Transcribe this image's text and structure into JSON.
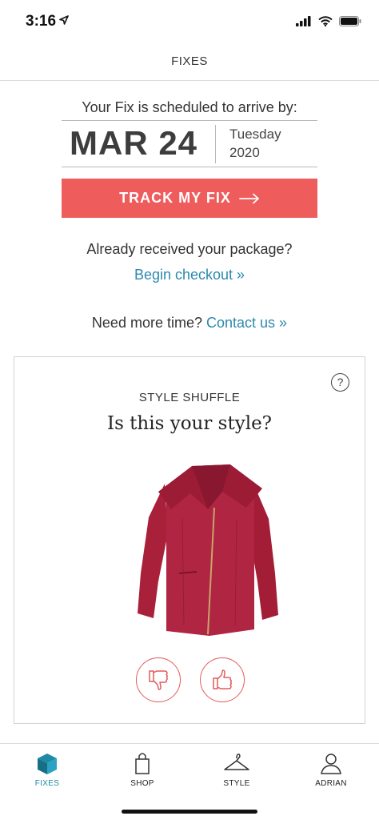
{
  "status_bar": {
    "time": "3:16"
  },
  "header": {
    "title": "FIXES"
  },
  "schedule": {
    "caption": "Your Fix is scheduled to arrive by:",
    "date": "MAR 24",
    "weekday": "Tuesday",
    "year": "2020"
  },
  "track_button": {
    "label": "TRACK MY FIX"
  },
  "checkout": {
    "question": "Already received your package?",
    "link": "Begin checkout »"
  },
  "more_time": {
    "question": "Need more time?",
    "link": "Contact us »"
  },
  "style_shuffle": {
    "help": "?",
    "kicker": "STYLE SHUFFLE",
    "heading": "Is this your style?",
    "item_color": "#a8203a"
  },
  "tabbar": {
    "tabs": [
      {
        "label": "FIXES",
        "active": true
      },
      {
        "label": "SHOP",
        "active": false
      },
      {
        "label": "STYLE",
        "active": false
      },
      {
        "label": "ADRIAN",
        "active": false
      }
    ]
  },
  "colors": {
    "accent_red": "#ef5c5c",
    "link_blue": "#2c8aae",
    "active_tab": "#1e8aa6"
  }
}
